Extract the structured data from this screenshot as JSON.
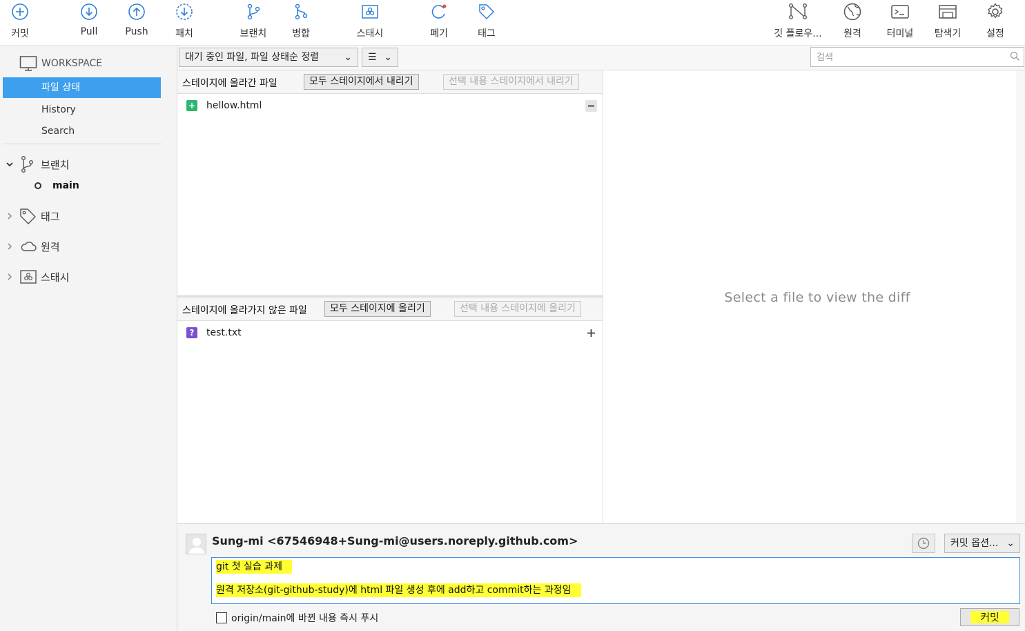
{
  "toolbar": {
    "commit": "커밋",
    "pull": "Pull",
    "push": "Push",
    "patch": "패치",
    "branch": "브랜치",
    "merge": "병합",
    "stash": "스태시",
    "discard": "폐기",
    "tag": "태그",
    "gitflow": "깃 플로우...",
    "remote": "원격",
    "terminal": "터미널",
    "explorer": "탐색기",
    "settings": "설정"
  },
  "sidebar": {
    "workspace": "WORKSPACE",
    "items": [
      {
        "label": "파일 상태",
        "selected": true
      },
      {
        "label": "History",
        "selected": false
      },
      {
        "label": "Search",
        "selected": false
      }
    ],
    "branches_label": "브랜치",
    "current_branch": "main",
    "tags_label": "태그",
    "remotes_label": "원격",
    "stashes_label": "스태시"
  },
  "filterbar": {
    "status_filter": "대기 중인 파일, 파일 상태순 정렬",
    "view_mode": "☰",
    "search_placeholder": "검색"
  },
  "staged": {
    "title": "스테이지에 올라간 파일",
    "unstage_all": "모두 스테이지에서 내리기",
    "unstage_selected": "선택 내용 스테이지에서 내리기",
    "files": [
      {
        "name": "hellow.html",
        "status": "added"
      }
    ]
  },
  "unstaged": {
    "title": "스테이지에 올라가지 않은 파일",
    "stage_all": "모두 스테이지에 올리기",
    "stage_selected": "선택 내용 스테이지에 올리기",
    "files": [
      {
        "name": "test.txt",
        "status": "untracked"
      }
    ]
  },
  "diff": {
    "placeholder": "Select a file to view the diff"
  },
  "commit": {
    "author": "Sung-mi <67546948+Sung-mi@users.noreply.github.com>",
    "options": "커밋 옵션...",
    "message_line1": "git 첫 실습 과제",
    "message_line2": "원격 저장소(git-github-study)에 html 파일 생성 후에 add하고 commit하는 과정임",
    "push_checkbox": "origin/main에 바뀐 내용 즉시 푸시",
    "push_checked": false,
    "commit_button": "커밋"
  },
  "colors": {
    "accent": "#3d9fed",
    "icon_blue": "#2f7fd6",
    "added": "#2bb673",
    "untracked": "#7b4fcf",
    "highlight": "#ffff33"
  }
}
